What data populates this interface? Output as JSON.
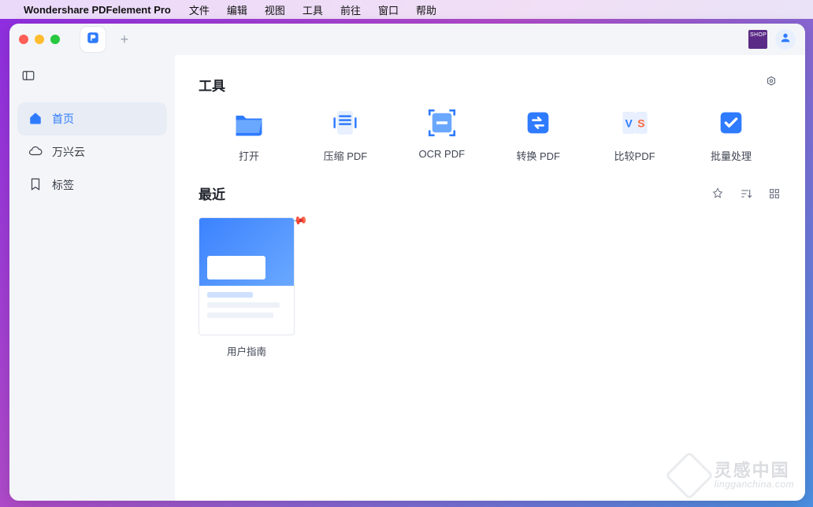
{
  "menubar": {
    "app": "Wondershare PDFelement Pro",
    "items": [
      "文件",
      "编辑",
      "视图",
      "工具",
      "前往",
      "窗口",
      "帮助"
    ]
  },
  "titlebar": {
    "plus": "+"
  },
  "sidebar": {
    "items": [
      {
        "label": "首页",
        "icon": "home-icon",
        "active": true
      },
      {
        "label": "万兴云",
        "icon": "cloud-icon",
        "active": false
      },
      {
        "label": "标签",
        "icon": "bookmark-icon",
        "active": false
      }
    ]
  },
  "sections": {
    "tools_title": "工具",
    "recent_title": "最近"
  },
  "tools": [
    {
      "label": "打开",
      "icon": "open-folder-icon"
    },
    {
      "label": "压缩 PDF",
      "icon": "compress-icon"
    },
    {
      "label": "OCR PDF",
      "icon": "ocr-icon"
    },
    {
      "label": "转换 PDF",
      "icon": "convert-icon"
    },
    {
      "label": "比较PDF",
      "icon": "compare-icon"
    },
    {
      "label": "批量处理",
      "icon": "batch-icon"
    }
  ],
  "recent": [
    {
      "label": "用户指南",
      "pinned": true
    }
  ],
  "watermark": {
    "zh": "灵感中国",
    "en": "lingganchina.com"
  }
}
